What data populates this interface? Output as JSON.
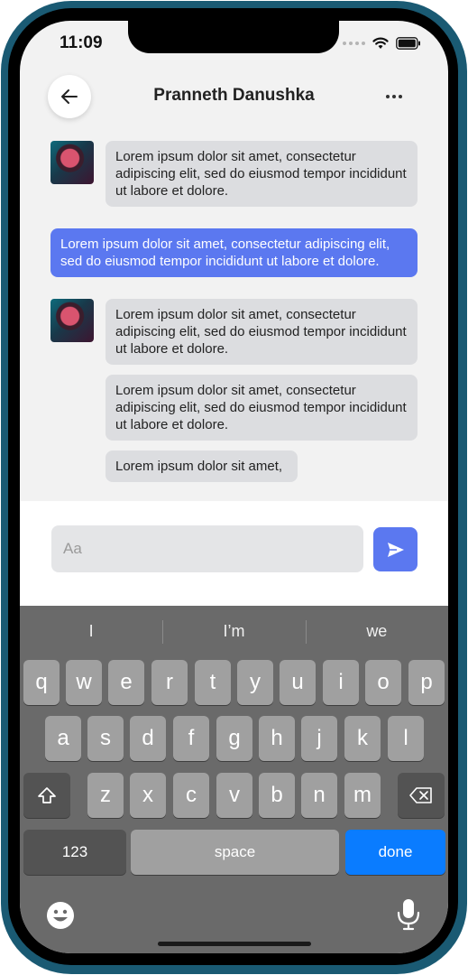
{
  "status_bar": {
    "time": "11:09"
  },
  "header": {
    "contact_name": "Pranneth Danushka"
  },
  "messages": [
    {
      "side": "received",
      "text": "Lorem ipsum dolor sit amet, consectetur adipiscing elit, sed do eiusmod tempor incididunt ut labore et dolore."
    },
    {
      "side": "sent",
      "text": "Lorem ipsum dolor sit amet, consectetur adipiscing elit, sed do eiusmod tempor incididunt ut labore et dolore."
    },
    {
      "side": "received",
      "text": "Lorem ipsum dolor sit amet, consectetur adipiscing elit, sed do eiusmod tempor incididunt ut labore et dolore."
    },
    {
      "side": "received",
      "text": "Lorem ipsum dolor sit amet, consectetur adipiscing elit, sed do eiusmod tempor incididunt ut labore et dolore."
    },
    {
      "side": "received",
      "text": "Lorem ipsum dolor sit amet,"
    }
  ],
  "composer": {
    "placeholder": "Aa"
  },
  "keyboard": {
    "suggestions": [
      "I",
      "I’m",
      "we"
    ],
    "row1": [
      "q",
      "w",
      "e",
      "r",
      "t",
      "y",
      "u",
      "i",
      "o",
      "p"
    ],
    "row2": [
      "a",
      "s",
      "d",
      "f",
      "g",
      "h",
      "j",
      "k",
      "l"
    ],
    "row3": [
      "z",
      "x",
      "c",
      "v",
      "b",
      "n",
      "m"
    ],
    "numbers_label": "123",
    "space_label": "space",
    "done_label": "done"
  },
  "colors": {
    "accent": "#5b78f0",
    "received_bubble": "#dcdde0",
    "done_key": "#0a7cff",
    "frame": "#1a5a73"
  },
  "icons": [
    "back-arrow-icon",
    "more-dots-icon",
    "send-icon",
    "shift-icon",
    "backspace-icon",
    "emoji-icon",
    "microphone-icon",
    "wifi-icon",
    "battery-icon",
    "signal-icon"
  ]
}
